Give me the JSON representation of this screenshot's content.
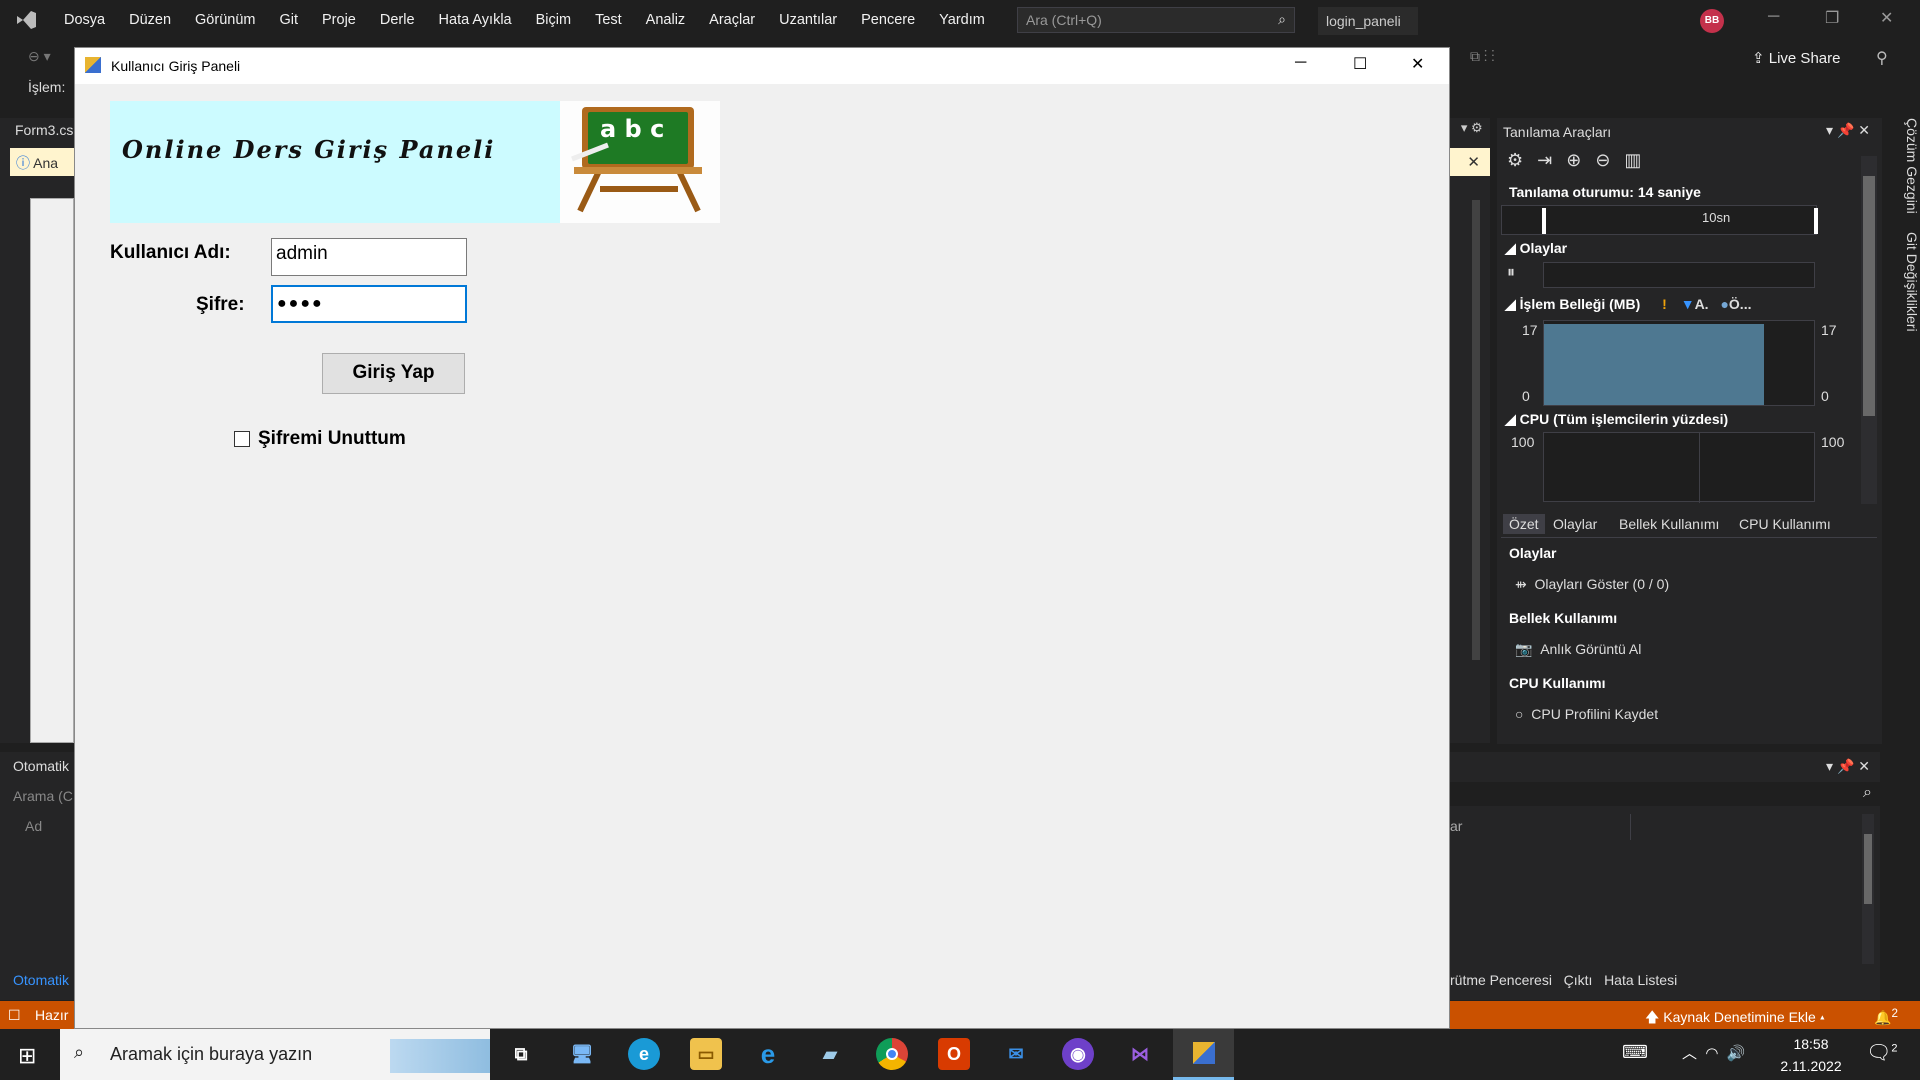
{
  "menubar": {
    "items": [
      "Dosya",
      "Düzen",
      "Görünüm",
      "Git",
      "Proje",
      "Derle",
      "Hata Ayıkla",
      "Biçim",
      "Test",
      "Analiz",
      "Araçlar",
      "Uzantılar",
      "Pencere",
      "Yardım"
    ],
    "search_placeholder": "Ara (Ctrl+Q)",
    "project_name": "login_paneli",
    "avatar_initials": "BB",
    "live_share": "Live Share"
  },
  "toolbar": {
    "islem_label": "İşlem:"
  },
  "editor": {
    "tab": "Form3.cs",
    "infobar": "Ana"
  },
  "form_window": {
    "title": "Kullanıcı Giriş Paneli",
    "banner_text": "Online Ders Giriş Paneli",
    "board_letters": "a b c",
    "username_label": "Kullanıcı Adı:",
    "username_value": "admin",
    "password_label": "Şifre:",
    "password_value": "●●●●",
    "login_button": "Giriş Yap",
    "forgot_label": "Şifremi Unuttum"
  },
  "left_bottom": {
    "title": "Otomatik",
    "search": "Arama (C",
    "col": "Ad",
    "tab": "Otomatik"
  },
  "diagnostics": {
    "title": "Tanılama Araçları",
    "session": "Tanılama oturumu: 14 saniye",
    "timeline_label": "10sn",
    "events_header": "Olaylar",
    "memory_header": "İşlem Belleği (MB)",
    "memory_legend_a": "A.",
    "memory_legend_o": "Ö...",
    "memory_max": "17",
    "memory_min": "0",
    "cpu_header": "CPU (Tüm işlemcilerin yüzdesi)",
    "cpu_max": "100",
    "tabs": [
      "Özet",
      "Olaylar",
      "Bellek Kullanımı",
      "CPU Kullanımı"
    ],
    "sec_events": "Olaylar",
    "show_events": "Olayları Göster (0 / 0)",
    "sec_memory": "Bellek Kullanımı",
    "snapshot": "Anlık Görüntü Al",
    "sec_cpu": "CPU Kullanımı",
    "cpu_profile": "CPU Profilini Kaydet",
    "memory_fill": 0.97
  },
  "right_vertical": {
    "solution": "Çözüm Gezgini",
    "git": "Git Değişiklikleri"
  },
  "bottom_right": {
    "col": "ar",
    "tabs": [
      "rütme Penceresi",
      "Çıktı",
      "Hata Listesi"
    ]
  },
  "statusbar": {
    "ready": "Hazır",
    "source_control": "Kaynak Denetimine Ekle",
    "notifications": "2"
  },
  "taskbar": {
    "search": "Aramak için buraya yazın",
    "time": "18:58",
    "date": "2.11.2022",
    "notif_count": "2"
  },
  "colors": {
    "accent": "#007acc",
    "status": "#ca5100",
    "banner": "#ccfbff",
    "memory_fill": "#4e7891"
  }
}
